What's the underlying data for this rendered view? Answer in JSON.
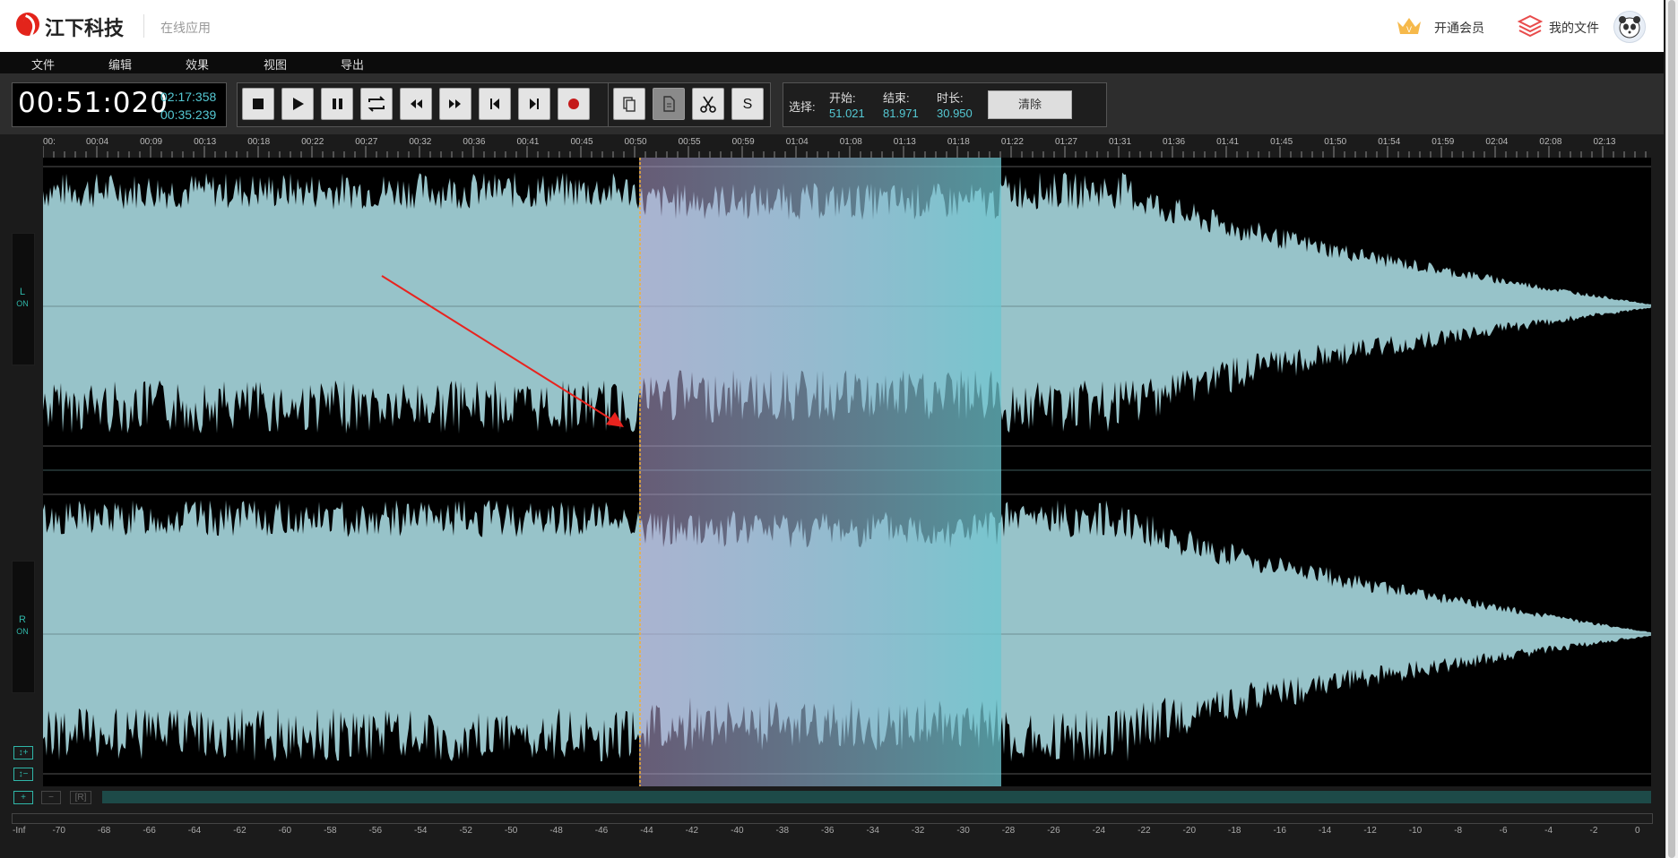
{
  "header": {
    "brand": "江下科技",
    "subtitle": "在线应用",
    "vip_label": "开通会员",
    "files_label": "我的文件"
  },
  "menu": [
    "文件",
    "编辑",
    "效果",
    "视图",
    "导出"
  ],
  "time": {
    "current": "00:51:020",
    "total": "02:17:358",
    "position": "00:35:239"
  },
  "toolbar_icons": [
    "stop-icon",
    "play-icon",
    "pause-icon",
    "loop-icon",
    "rewind-icon",
    "fast-forward-icon",
    "skip-start-icon",
    "skip-end-icon",
    "record-icon",
    "copy-icon",
    "paste-icon",
    "cut-icon",
    "silence-icon"
  ],
  "silence_label": "S",
  "selection": {
    "label": "选择:",
    "start_label": "开始:",
    "start_value": "51.021",
    "end_label": "结束:",
    "end_value": "81.971",
    "duration_label": "时长:",
    "duration_value": "30.950",
    "clear_label": "清除"
  },
  "ruler_ticks": [
    "00:",
    "00:04",
    "00:09",
    "00:13",
    "00:18",
    "00:22",
    "00:27",
    "00:32",
    "00:36",
    "00:41",
    "00:45",
    "00:50",
    "00:55",
    "00:59",
    "01:04",
    "01:08",
    "01:13",
    "01:18",
    "01:22",
    "01:27",
    "01:31",
    "01:36",
    "01:41",
    "01:45",
    "01:50",
    "01:54",
    "01:59",
    "02:04",
    "02:08",
    "02:13"
  ],
  "channels": {
    "left_label": "L",
    "left_state": "ON",
    "right_label": "R",
    "right_state": "ON"
  },
  "zoom_controls": {
    "v_zoom_in": "↕+",
    "v_zoom_out": "↕−",
    "h_zoom_in": "+",
    "h_zoom_out": "−",
    "reset": "[R]"
  },
  "meter_scale": [
    "-Inf",
    "-70",
    "-68",
    "-66",
    "-64",
    "-62",
    "-60",
    "-58",
    "-56",
    "-54",
    "-52",
    "-50",
    "-48",
    "-46",
    "-44",
    "-42",
    "-40",
    "-38",
    "-36",
    "-34",
    "-32",
    "-30",
    "-28",
    "-26",
    "-24",
    "-22",
    "-20",
    "-18",
    "-16",
    "-14",
    "-12",
    "-10",
    "-8",
    "-6",
    "-4",
    "-2",
    "0"
  ],
  "colors": {
    "waveform": "#97c3c9",
    "selection_start": "#b9a7d6",
    "selection_end": "#6dc6cf",
    "accent": "#2fb6a8",
    "cursor": "#f2b233",
    "arrow": "#e8231e"
  }
}
